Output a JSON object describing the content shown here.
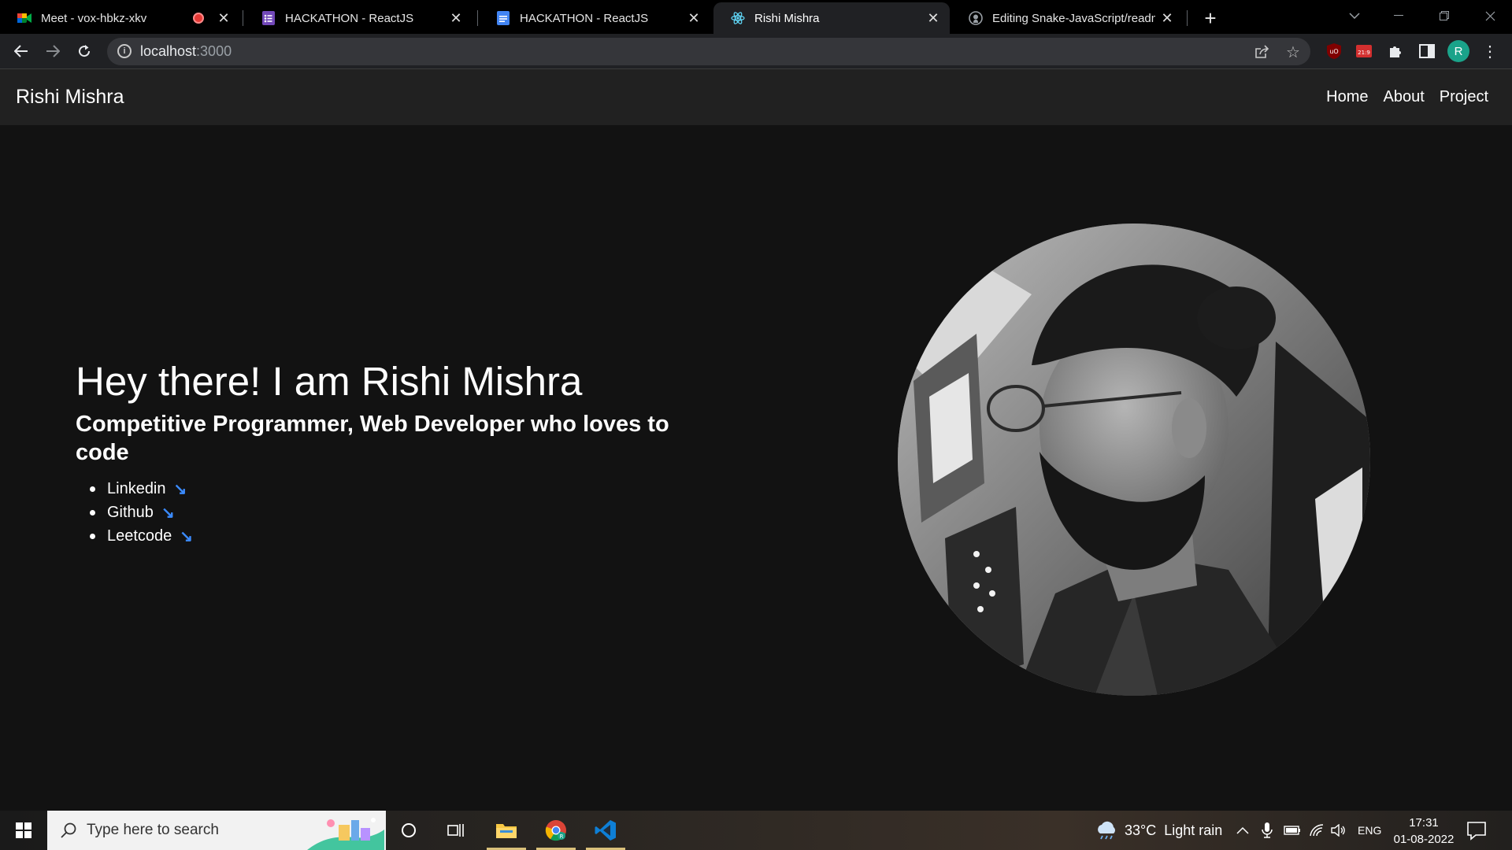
{
  "browser": {
    "tabs": [
      {
        "title": "Meet - vox-hbkz-xkv",
        "icon": "google-meet-icon",
        "recording": true
      },
      {
        "title": "HACKATHON - ReactJS",
        "icon": "google-forms-icon"
      },
      {
        "title": "HACKATHON - ReactJS",
        "icon": "google-docs-icon"
      },
      {
        "title": "Rishi Mishra",
        "icon": "react-icon",
        "active": true
      },
      {
        "title": "Editing Snake-JavaScript/readme",
        "icon": "github-icon"
      }
    ],
    "address": {
      "host": "localhost",
      "port": ":3000"
    },
    "profile_initial": "R",
    "extension_badge": "21:9"
  },
  "site": {
    "brand": "Rishi Mishra",
    "nav": [
      "Home",
      "About",
      "Project"
    ],
    "hero": {
      "title": "Hey there! I am Rishi Mishra",
      "subtitle": "Competitive Programmer, Web Developer who loves to code",
      "links": [
        "Linkedin",
        "Github",
        "Leetcode"
      ],
      "link_arrow": "↘"
    }
  },
  "taskbar": {
    "search_placeholder": "Type here to search",
    "weather": {
      "temp": "33°C",
      "condition": "Light rain"
    },
    "language": "ENG",
    "time": "17:31",
    "date": "01-08-2022"
  },
  "colors": {
    "accent_link_arrow": "#3b8bff",
    "page_bg": "#121212",
    "navbar_bg": "#212121"
  }
}
